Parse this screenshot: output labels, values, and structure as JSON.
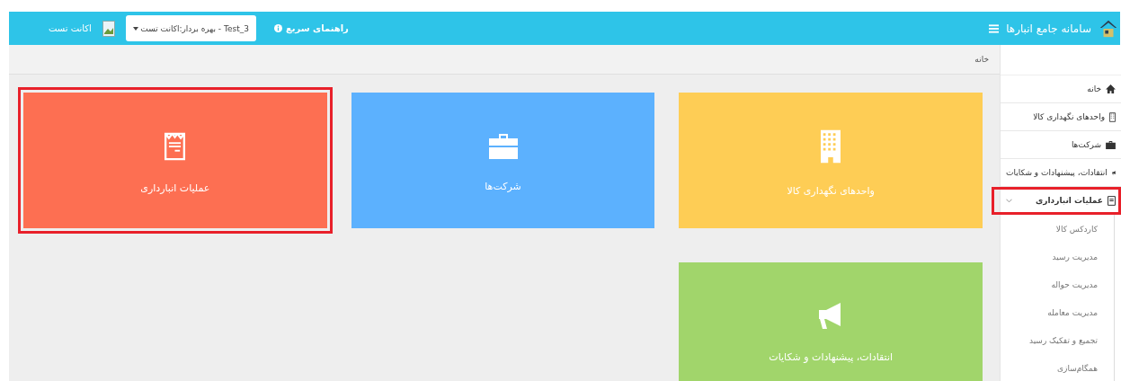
{
  "header": {
    "title": "سامانه جامع انبارها",
    "quick_help": "راهنمای سریع",
    "account_select": {
      "value": "Test_3 - بهره بردار:اکانت تست"
    },
    "user_name": "اکانت تست"
  },
  "breadcrumb": "خانه",
  "sidebar": {
    "items": [
      {
        "label": "خانه",
        "kind": "home",
        "highlighted": false,
        "expanded": false
      },
      {
        "label": "واحدهای نگهداری کالا",
        "kind": "building",
        "highlighted": false,
        "expanded": false
      },
      {
        "label": "شرکت‌ها",
        "kind": "briefcase",
        "highlighted": false,
        "expanded": false
      },
      {
        "label": "انتقادات، پیشنهادات و شکایات",
        "kind": "bullhorn",
        "highlighted": false,
        "expanded": false
      },
      {
        "label": "عملیات انبارداری",
        "kind": "receipt",
        "highlighted": true,
        "expanded": true,
        "children": [
          {
            "label": "کاردکس کالا"
          },
          {
            "label": "مدیریت رسید"
          },
          {
            "label": "مدیریت حواله"
          },
          {
            "label": "مدیریت معامله"
          },
          {
            "label": "تجمیع و تفکیک رسید"
          },
          {
            "label": "همگام‌سازی"
          }
        ]
      }
    ]
  },
  "tiles": [
    {
      "label": "واحدهای نگهداری کالا",
      "kind": "building",
      "color": "#fecd55",
      "highlighted": false
    },
    {
      "label": "شرکت‌ها",
      "kind": "briefcase",
      "color": "#5cb1fe",
      "highlighted": false
    },
    {
      "label": "عملیات انبارداری",
      "kind": "receipt",
      "color": "#fd6f52",
      "highlighted": true
    },
    {
      "label": "انتقادات، پیشنهادات و شکایات",
      "kind": "bullhorn",
      "color": "#a1d56b",
      "highlighted": false
    }
  ]
}
